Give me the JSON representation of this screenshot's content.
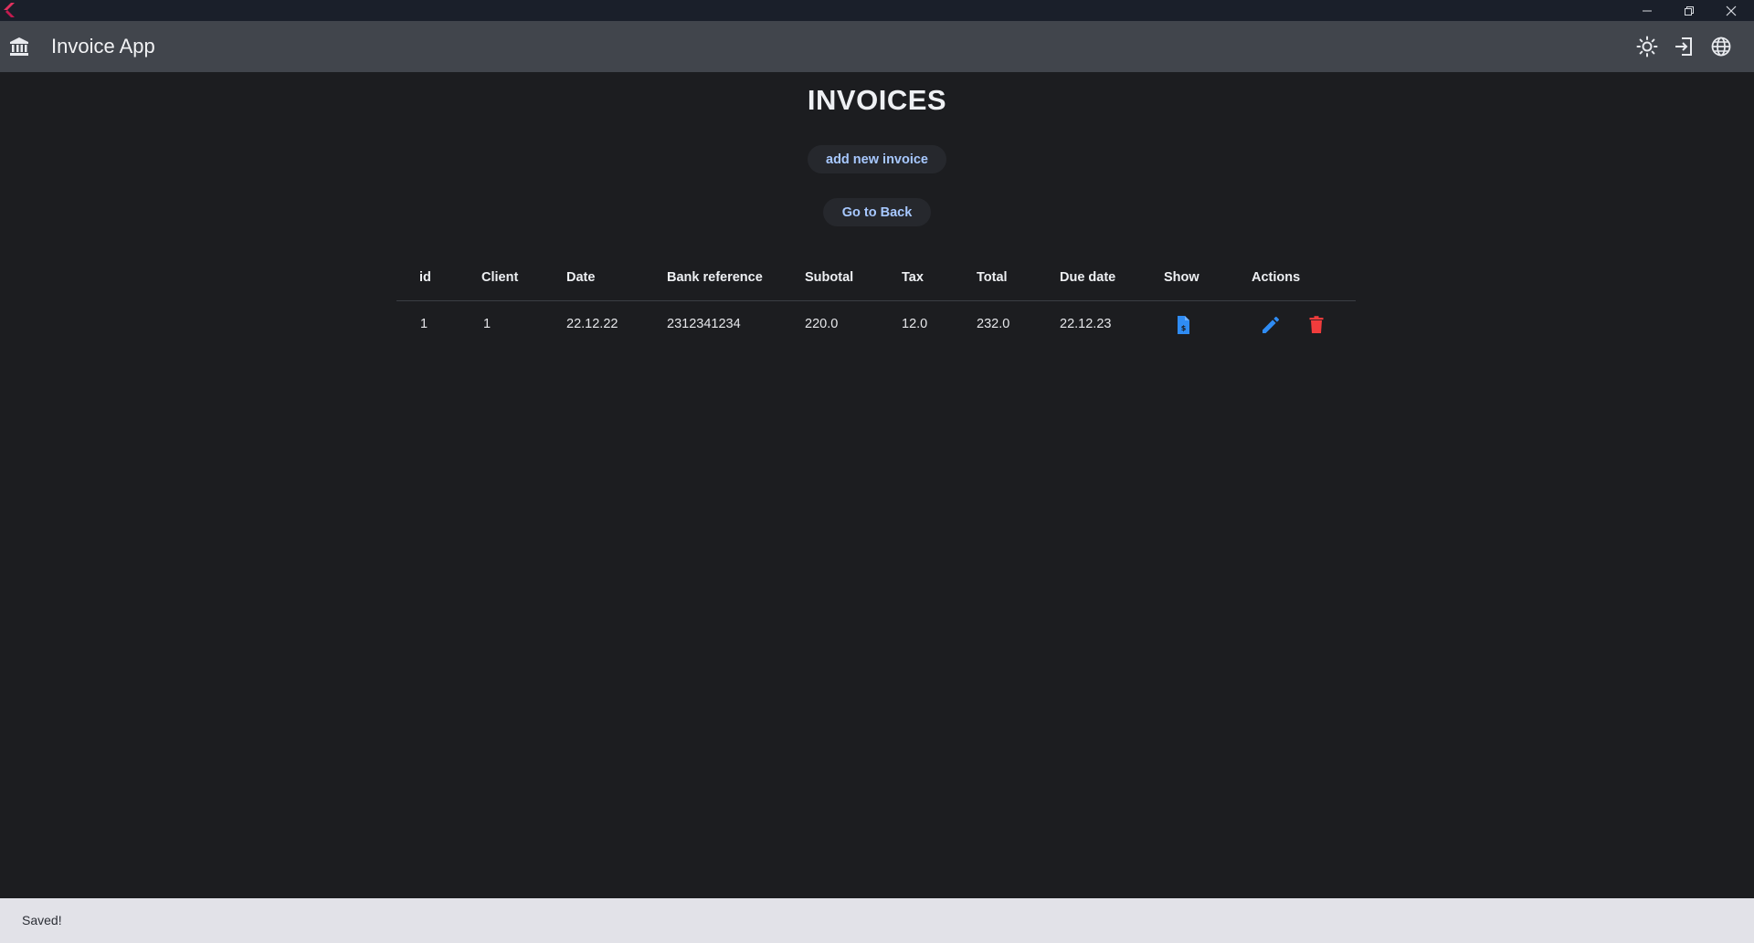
{
  "window": {
    "controls": [
      "minimize",
      "restore",
      "close"
    ]
  },
  "appbar": {
    "title": "Invoice App",
    "icons": [
      "bank-icon",
      "sun-icon",
      "logout-icon",
      "globe-icon"
    ]
  },
  "page": {
    "title": "INVOICES",
    "add_button": "add new invoice",
    "back_button": "Go to Back"
  },
  "table": {
    "headers": [
      "id",
      "Client",
      "Date",
      "Bank reference",
      "Subotal",
      "Tax",
      "Total",
      "Due date",
      "Show",
      "Actions"
    ],
    "rows": [
      {
        "id": "1",
        "client": "1",
        "date": "22.12.22",
        "bank_reference": "2312341234",
        "subtotal": "220.0",
        "tax": "12.0",
        "total": "232.0",
        "due_date": "22.12.23"
      }
    ]
  },
  "snackbar": {
    "message": "Saved!"
  },
  "colors": {
    "background": "#1c1d20",
    "appbar": "#41454c",
    "accent_blue": "#2f8cf4",
    "delete_red": "#f13c3c",
    "button_text": "#a7c8ff"
  }
}
